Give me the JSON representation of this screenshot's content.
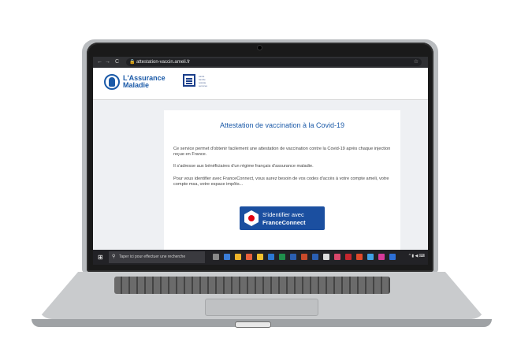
{
  "browser": {
    "url": "attestation-vaccin.ameli.fr",
    "nav_back": "←",
    "nav_forward": "→",
    "nav_reload": "C"
  },
  "header": {
    "logo_line1": "L'Assurance",
    "logo_line2": "Maladie",
    "rf_line1": "santé",
    "rf_line2": "famille",
    "rf_line3": "retraite",
    "rf_line4": "services"
  },
  "card": {
    "title": "Attestation de vaccination à la Covid-19",
    "p1": "Ce service permet d'obtenir facilement une attestation de vaccination contre la Covid-19 après chaque injection reçue en France.",
    "p2": "Il s'adresse aux bénéficiaires d'un régime français d'assurance maladie.",
    "p3": "Pour vous identifier avec FranceConnect, vous aurez besoin de vos codes d'accès à votre compte ameli, votre compte msa, votre espace impôts...",
    "button_line1": "S'identifier avec",
    "button_line2": "FranceConnect"
  },
  "taskbar": {
    "search_placeholder": "Taper ici pour effectuer une recherche"
  },
  "colors": {
    "ameli_blue": "#1b5aa8",
    "franceconnect_blue": "#1b4fa0",
    "taskbar": "#222226"
  }
}
